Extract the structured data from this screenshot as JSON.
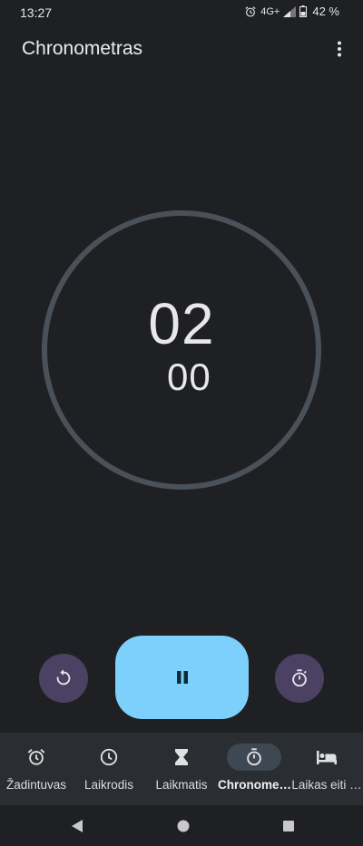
{
  "status": {
    "time": "13:27",
    "network": "4G+",
    "battery": "42 %"
  },
  "app": {
    "title": "Chronometras"
  },
  "stopwatch": {
    "main": "02",
    "sub": "00"
  },
  "colors": {
    "background": "#1f2023",
    "ring": "#4a5158",
    "accent": "#7cd0fb",
    "secondary_button": "#4b4263",
    "nav_background": "#2a2e33",
    "nav_active_pill": "#3d4853"
  },
  "controls": {
    "reset_icon": "reset-icon",
    "pause_icon": "pause-icon",
    "lap_icon": "stopwatch-icon"
  },
  "nav": {
    "items": [
      {
        "label": "Žadintuvas",
        "icon": "alarm-icon"
      },
      {
        "label": "Laikrodis",
        "icon": "clock-icon"
      },
      {
        "label": "Laikmatis",
        "icon": "hourglass-icon"
      },
      {
        "label": "Chronome…",
        "icon": "stopwatch-icon",
        "active": true
      },
      {
        "label": "Laikas eiti …",
        "icon": "bed-icon"
      }
    ]
  }
}
